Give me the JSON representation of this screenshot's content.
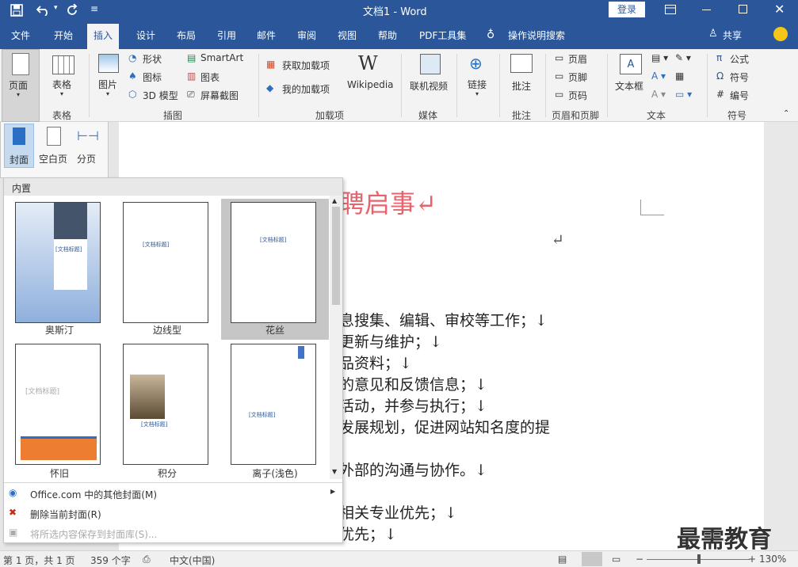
{
  "app": {
    "title": "文档1 - Word",
    "login": "登录"
  },
  "tabs": [
    "文件",
    "开始",
    "插入",
    "设计",
    "布局",
    "引用",
    "邮件",
    "审阅",
    "视图",
    "帮助",
    "PDF工具集",
    "操作说明搜索",
    "共享"
  ],
  "ribbon": {
    "page": "页面",
    "table": "表格",
    "picture": "图片",
    "shapes": "形状",
    "icons": "图标",
    "model3d": "3D 模型",
    "smartart": "SmartArt",
    "chart": "图表",
    "screenshot": "屏幕截图",
    "get_addins": "获取加载项",
    "my_addins": "我的加载项",
    "wikipedia": "Wikipedia",
    "online_video": "联机视频",
    "link": "链接",
    "comment": "批注",
    "header": "页眉",
    "footer": "页脚",
    "page_number": "页码",
    "textbox": "文本框",
    "equation": "公式",
    "symbol": "符号",
    "numbering": "编号",
    "groups": {
      "table": "表格",
      "illustrations": "插图",
      "addins": "加载项",
      "media": "媒体",
      "comments": "批注",
      "header_footer": "页眉和页脚",
      "text": "文本",
      "symbols": "符号"
    }
  },
  "page_menu": {
    "cover": "封面",
    "blank": "空白页",
    "break": "分页"
  },
  "gallery": {
    "heading": "内置",
    "thumbs": [
      {
        "label": "奥斯汀",
        "title": "[文档标题]"
      },
      {
        "label": "边线型",
        "title": "[文档标题]"
      },
      {
        "label": "花丝",
        "title": "[文档标题]"
      },
      {
        "label": "怀旧",
        "title": "[文档标题]"
      },
      {
        "label": "积分",
        "title": "[文档标题]"
      },
      {
        "label": "离子(浅色)",
        "title": "[文档标题]"
      }
    ],
    "menu": [
      "Office.com 中的其他封面(M)",
      "删除当前封面(R)",
      "将所选内容保存到封面库(S)..."
    ]
  },
  "document": {
    "heading": "聘启事↵",
    "lines": [
      "↵",
      "息搜集、编辑、审校等工作；↓",
      "更新与维护；↓",
      "品资料；↓",
      "的意见和反馈信息；↓",
      "活动，并参与执行；↓",
      "发展规划，促进网站知名度的提",
      "外部的沟通与协作。↓",
      "相关专业优先；↓",
      "优先；↓"
    ]
  },
  "status": {
    "pages": "第 1 页，共 1 页",
    "words": "359 个字",
    "language": "中文(中国)",
    "zoom": "130%"
  },
  "watermark": "最需教育",
  "colors": {
    "accent": "#2b579a",
    "heading": "#e8636b",
    "orange": "#ed7d31"
  }
}
